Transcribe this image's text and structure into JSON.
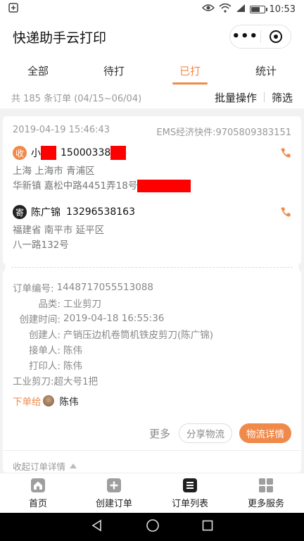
{
  "status_bar": {
    "time": "10:53"
  },
  "app": {
    "title": "快递助手云打印"
  },
  "tabs": [
    {
      "label": "全部"
    },
    {
      "label": "待打"
    },
    {
      "label": "已打"
    },
    {
      "label": "统计"
    }
  ],
  "summary": {
    "text": "共 185 条订单 (04/15~06/04)",
    "batch_label": "批量操作",
    "filter_label": "筛选"
  },
  "order": {
    "time": "2019-04-19 15:46:43",
    "express": "EMS经济快件:9705809383151",
    "receiver": {
      "badge": "收",
      "name": "小",
      "phone": "15000338",
      "addr_line1": "上海 上海市 青浦区",
      "addr_line2": "华新镇 嘉松中路4451弄18号"
    },
    "sender": {
      "badge": "寄",
      "name": "陈广锦",
      "phone": "13296538163",
      "addr_line1": "福建省 南平市 延平区",
      "addr_line2": "八一路132号"
    },
    "details": {
      "order_no_label": "订单编号:",
      "order_no": "1448717055513088",
      "category_label": "品类:",
      "category": "工业剪刀",
      "created_label": "创建时间:",
      "created": "2019-04-18 16:55:36",
      "creator_label": "创建人:",
      "creator": "产销压边机卷筒机铁皮剪刀(陈广锦)",
      "receiver_label": "接单人:",
      "receiver": "陈伟",
      "printer_label": "打印人:",
      "printer": "陈伟",
      "item_line": "工业剪刀:超大号1把",
      "assign_label": "下单给",
      "assign_name": "陈伟"
    },
    "buttons": {
      "more": "更多",
      "share": "分享物流",
      "track": "物流详情"
    },
    "collapse_label": "收起订单详情"
  },
  "bottom_nav": [
    {
      "label": "首页",
      "icon": "home-icon"
    },
    {
      "label": "创建订单",
      "icon": "plus-icon"
    },
    {
      "label": "订单列表",
      "icon": "list-icon"
    },
    {
      "label": "更多服务",
      "icon": "grid-icon"
    }
  ],
  "colors": {
    "accent": "#f08a4b",
    "redaction": "#ff0000"
  }
}
